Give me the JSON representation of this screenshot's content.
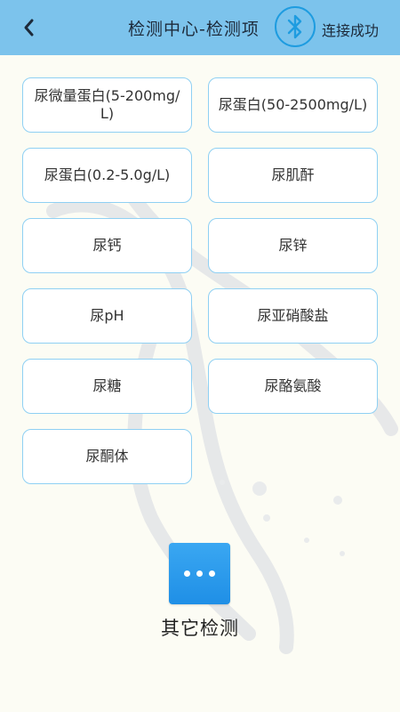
{
  "header": {
    "title": "检测中心-检测项",
    "status": "连接成功"
  },
  "items": [
    {
      "label": "尿微量蛋白(5-200mg/L)"
    },
    {
      "label": "尿蛋白(50-2500mg/L)"
    },
    {
      "label": "尿蛋白(0.2-5.0g/L)"
    },
    {
      "label": "尿肌酐"
    },
    {
      "label": "尿钙"
    },
    {
      "label": "尿锌"
    },
    {
      "label": "尿pH"
    },
    {
      "label": "尿亚硝酸盐"
    },
    {
      "label": "尿糖"
    },
    {
      "label": "尿酪氨酸"
    },
    {
      "label": "尿酮体"
    }
  ],
  "other": {
    "label": "其它检测"
  },
  "colors": {
    "header_bg": "#7cc3ec",
    "button_border": "#8fd0f3",
    "bluetooth": "#1e9ce0",
    "other_icon": "#2a9cee"
  },
  "icons": {
    "back": "chevron-left-icon",
    "bluetooth": "bluetooth-icon",
    "other": "more-dots-icon"
  }
}
